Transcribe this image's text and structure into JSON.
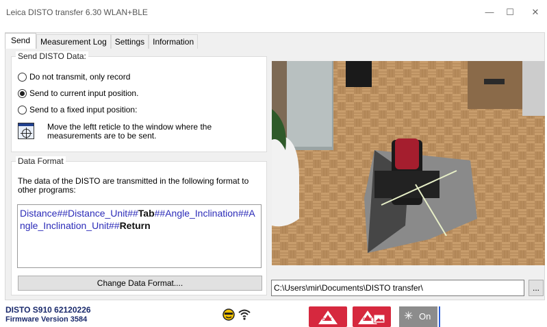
{
  "window": {
    "title": "Leica DISTO transfer 6.30  WLAN+BLE",
    "minimize": "—",
    "maximize": "☐",
    "close": "✕"
  },
  "tabs": [
    {
      "label": "Send",
      "active": true
    },
    {
      "label": "Measurement Log",
      "active": false
    },
    {
      "label": "Settings",
      "active": false
    },
    {
      "label": "Information",
      "active": false
    }
  ],
  "send_group": {
    "legend": "Send DISTO Data:",
    "options": [
      {
        "label": "Do not transmit, only record",
        "checked": false
      },
      {
        "label": "Send to current input position.",
        "checked": true
      },
      {
        "label": "Send to a fixed input position:",
        "checked": false
      }
    ],
    "reticle_hint": "Move the leftt reticle to the window where the measurements are to be sent."
  },
  "format_group": {
    "legend": "Data Format",
    "description": "The data of the DISTO are transmitted in the following format to other programs:",
    "format_parts": [
      {
        "text": "Distance##Distance_Unit##",
        "style": "blue"
      },
      {
        "text": "Tab",
        "style": "bold"
      },
      {
        "text": "##Angle_Inclination##Angle_Inclination_Unit##",
        "style": "blue"
      },
      {
        "text": "Return",
        "style": "bold"
      }
    ],
    "change_button": "Change Data Format...."
  },
  "path": {
    "value": "C:\\Users\\mir\\Documents\\DISTO transfer\\",
    "browse_label": "..."
  },
  "status": {
    "model": "DISTO S910 62120226",
    "firmware": "Firmware Version 3584",
    "dist_label": "DIST",
    "dist_photo_label": "DIST",
    "on_label": "On"
  },
  "icons": {
    "status_icon": "smiley-status-icon",
    "wifi_icon": "wifi-icon",
    "laser_icon": "laser-star-icon"
  },
  "colors": {
    "accent_red": "#d6283e",
    "format_blue": "#2b2bb8",
    "status_blue": "#1a2a6c"
  }
}
